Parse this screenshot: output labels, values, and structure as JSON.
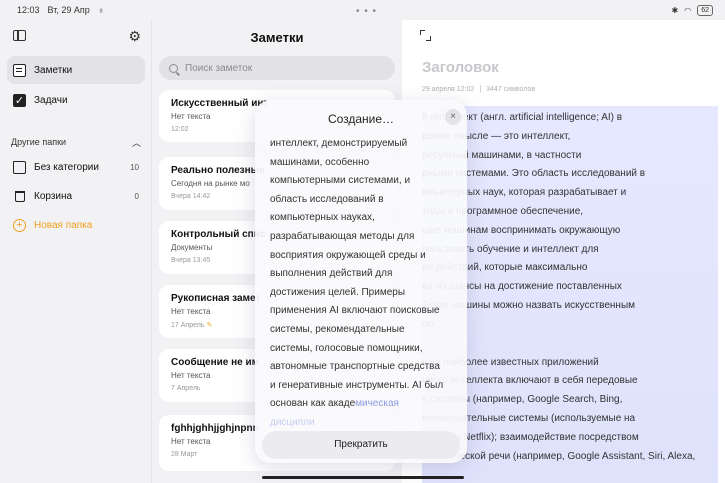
{
  "status": {
    "time": "12:03",
    "date": "Вт, 29 Апр",
    "battery": "62"
  },
  "sidebar": {
    "items": [
      {
        "label": "Заметки"
      },
      {
        "label": "Задачи"
      }
    ],
    "section_label": "Другие папки",
    "folders": [
      {
        "label": "Без категории",
        "count": "10"
      },
      {
        "label": "Корзина",
        "count": "0"
      }
    ],
    "new_folder": "Новая папка"
  },
  "notes": {
    "title": "Заметки",
    "search_placeholder": "Поиск заметок",
    "cards": [
      {
        "title": "Искусственный инт",
        "subtitle": "Нет текста",
        "date": "12:02"
      },
      {
        "title": "Реально полезные",
        "subtitle": "Сегодня на рынке мо",
        "date": "Вчера 14:42"
      },
      {
        "title": "Контрольный спис",
        "subtitle": "Документы",
        "date": "Вчера 13:45"
      },
      {
        "title": "Рукописная замет",
        "subtitle": "Нет текста",
        "date": "17 Апрель"
      },
      {
        "title": "Сообщение не им",
        "subtitle": "Нет текста",
        "date": "7 Апрель"
      },
      {
        "title": "fghhjghhjjghjnpnn",
        "subtitle": "Нет текста",
        "date": "28 Март"
      }
    ]
  },
  "editor": {
    "title": "Заголовок",
    "date": "29 апреля 12:02",
    "separator": "|",
    "chars": "3447 символов",
    "para1": "й интеллект (англ. artificial intelligence; AI) в\nроком смысле — это интеллект,\nрируемый машинами, в частности\nрными системами. Это область исследований в\nмпьютерных наук, которая разрабатывает и\nтоды и программное обеспечение,\nщие машинам воспринимать окружающую\nпользовать обучение и интеллект для\nия действий, которые максимально\nют их шансы на достижение поставленных\nТакие машины можно назвать искусственным\nом.",
    "para2": "е из наиболее известных приложений\nнного интеллекта включают в себя передовые\nе системы (например, Google Search, Bing,\nекомендательные системы (используемые на\nmazon и Netflix); взаимодействие посредством\nчеловеческой речи (например, Google Assistant, Siri, Alexa,"
  },
  "popup": {
    "title": "Создание…",
    "close": "×",
    "text": "интеллект, демонстрируемый\nмашинами, особенно\nкомпьютерными системами, и\nобласть исследований в\nкомпьютерных науках,\nразрабатывающая методы для\nвосприятия окружающей среды и\nвыполнения действий для\nдостижения целей. Примеры\nприменения AI включают поисковые\nсистемы, рекомендательные\nсистемы, голосовые помощники,\nавтономные транспортные средства\nи генеративные инструменты. AI был\nоснован как акаде",
    "text_fade": "мическая",
    "text_fade2": "дисципли",
    "stop_label": "Прекратить"
  }
}
